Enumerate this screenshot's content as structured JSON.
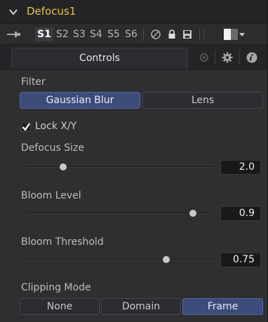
{
  "header": {
    "title": "Defocus1"
  },
  "toolbar": {
    "versions": [
      "S1",
      "S2",
      "S3",
      "S4",
      "S5",
      "S6"
    ],
    "active_version": "S1"
  },
  "tabs": {
    "controls_label": "Controls"
  },
  "filter": {
    "label": "Filter",
    "options": [
      "Gaussian Blur",
      "Lens"
    ],
    "selected": "Gaussian Blur"
  },
  "lock_xy": {
    "label": "Lock X/Y",
    "checked": true
  },
  "defocus_size": {
    "label": "Defocus Size",
    "value": "2.0",
    "slider_fraction": 0.2
  },
  "bloom_level": {
    "label": "Bloom Level",
    "value": "0.9",
    "slider_fraction": 0.89
  },
  "bloom_threshold": {
    "label": "Bloom Threshold",
    "value": "0.75",
    "slider_fraction": 0.75
  },
  "clipping_mode": {
    "label": "Clipping Mode",
    "options": [
      "None",
      "Domain",
      "Frame"
    ],
    "selected": "Frame"
  },
  "colors": {
    "title": "#e0c45a",
    "selected_button": "#3d4b79"
  },
  "icons": {
    "collapse": "chevron-down-icon",
    "pin": "pin-icon",
    "disable": "circle-slash-icon",
    "lock": "lock-icon",
    "save": "save-icon",
    "color_swatch": "color-swatch-icon",
    "tab_node": "node-icon",
    "tab_settings": "gear-icon",
    "tab_info": "info-icon"
  }
}
